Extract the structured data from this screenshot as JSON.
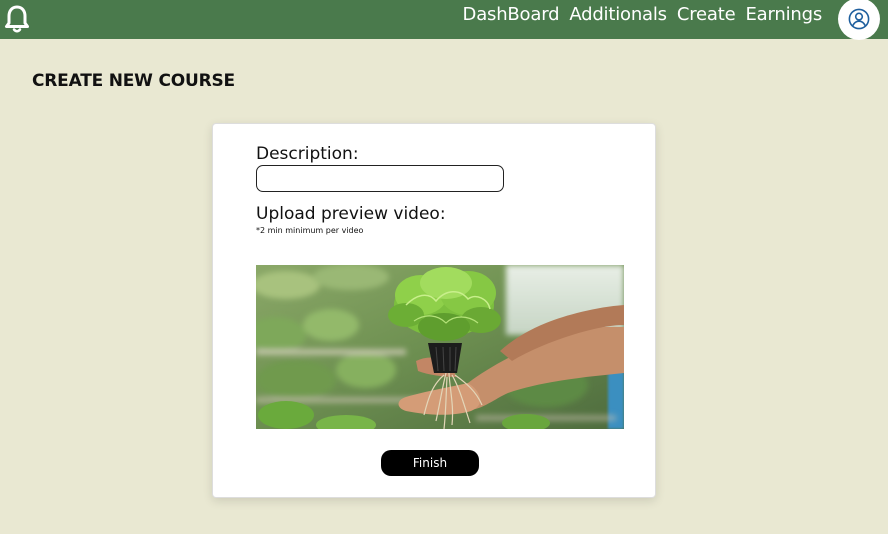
{
  "header": {
    "bell_icon": "bell-icon",
    "nav": [
      {
        "label": "DashBoard"
      },
      {
        "label": "Additionals"
      },
      {
        "label": "Create"
      },
      {
        "label": "Earnings"
      }
    ],
    "avatar_icon": "user-circle-icon",
    "bar_color": "#4a7a4c"
  },
  "page": {
    "title": "CREATE NEW COURSE",
    "background": "#e9e8d2"
  },
  "form": {
    "description_label": "Description:",
    "description_value": "",
    "upload_label": "Upload preview video:",
    "upload_hint": "*2 min minimum per video",
    "preview_image": "hands holding lettuce seedling with roots over hydroponic greenhouse",
    "finish_label": "Finish"
  }
}
